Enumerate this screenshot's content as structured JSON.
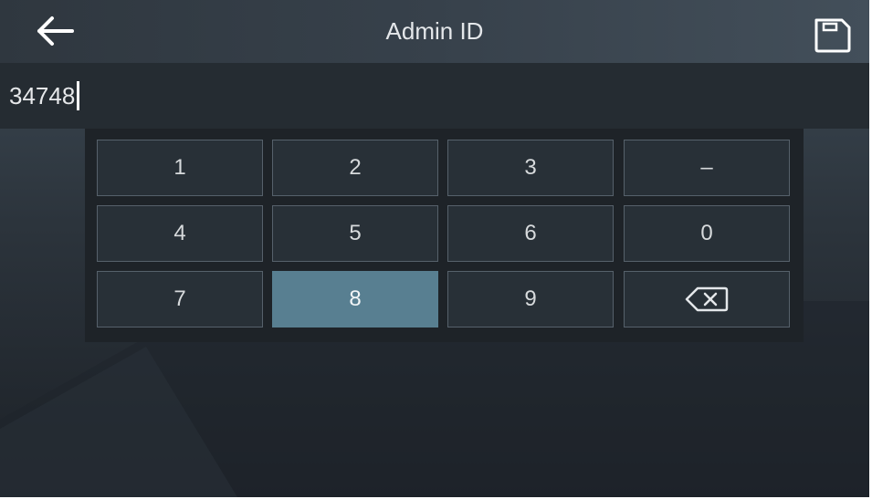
{
  "header": {
    "title": "Admin ID",
    "back_icon": "arrow-left-icon",
    "save_icon": "floppy-save-icon"
  },
  "input": {
    "value": "34748"
  },
  "keypad": {
    "keys": [
      {
        "label": "1"
      },
      {
        "label": "2"
      },
      {
        "label": "3"
      },
      {
        "label": "–"
      },
      {
        "label": "4"
      },
      {
        "label": "5"
      },
      {
        "label": "6"
      },
      {
        "label": "0"
      },
      {
        "label": "7"
      },
      {
        "label": "8",
        "state": "pressed"
      },
      {
        "label": "9"
      },
      {
        "label": "",
        "icon": "backspace-icon"
      }
    ]
  },
  "colors": {
    "header_bg": "#37414b",
    "input_bg": "#252c32",
    "keypad_bg": "#1e2328",
    "key_bg": "#283037",
    "key_border": "#56616b",
    "key_active_bg": "#587f91",
    "text": "#e4e7ea"
  }
}
